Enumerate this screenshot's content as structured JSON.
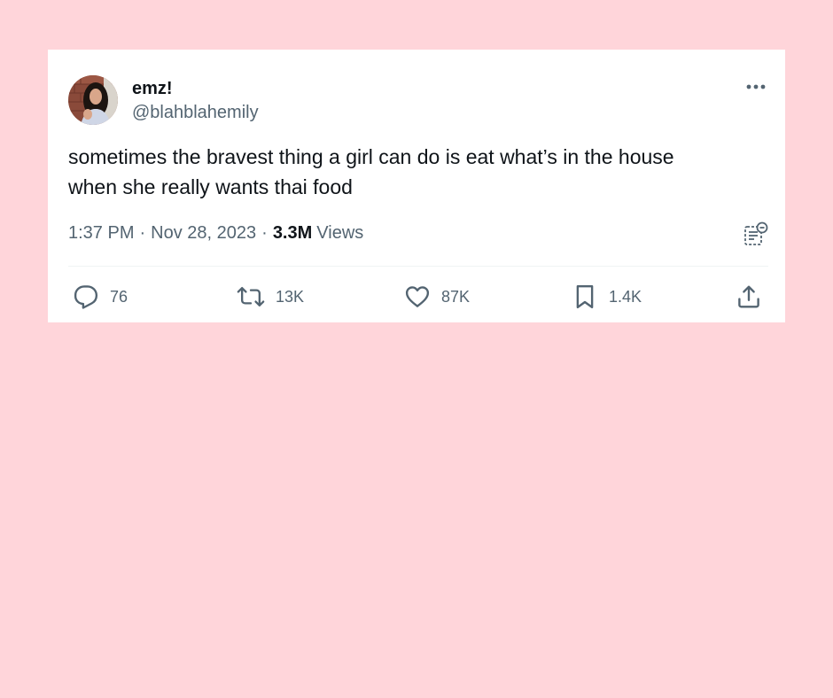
{
  "colors": {
    "page_background": "#ffd5da",
    "card_background": "#ffffff",
    "primary_text": "#0f1419",
    "secondary_text": "#536471",
    "divider": "#eff3f4"
  },
  "tweet": {
    "author": {
      "display_name": "emz!",
      "handle": "@blahblahemily",
      "avatar_icon": "profile-photo"
    },
    "more_icon": "ellipsis-icon",
    "text_lines": [
      "sometimes the bravest thing a girl can do is eat what’s in the house",
      "when she really wants thai food"
    ],
    "meta": {
      "time": "1:37 PM",
      "separator": "·",
      "date": "Nov 28, 2023",
      "views_count": "3.3M",
      "views_label": "Views"
    },
    "notes_icon": "community-notes-icon",
    "actions": {
      "reply": {
        "icon": "reply-icon",
        "count": "76"
      },
      "retweet": {
        "icon": "retweet-icon",
        "count": "13K"
      },
      "like": {
        "icon": "heart-icon",
        "count": "87K"
      },
      "bookmark": {
        "icon": "bookmark-icon",
        "count": "1.4K"
      },
      "share": {
        "icon": "share-icon"
      }
    }
  }
}
